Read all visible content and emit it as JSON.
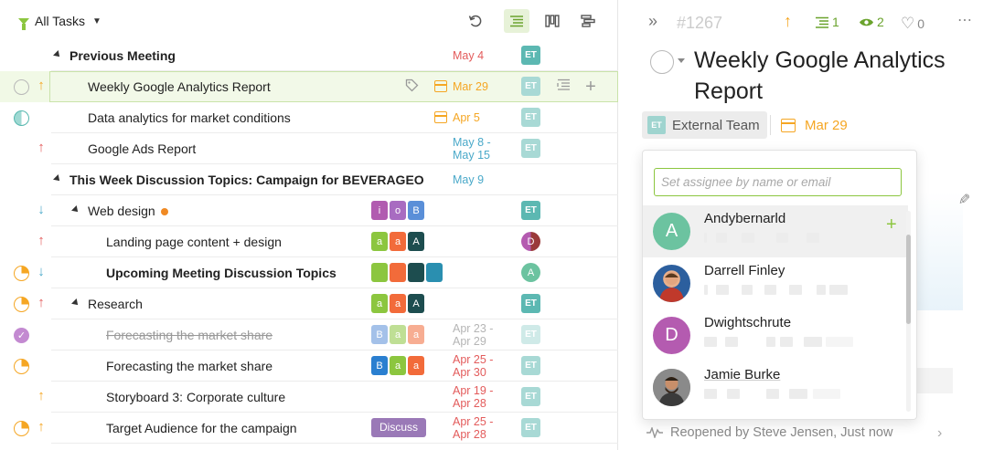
{
  "filter": {
    "label": "All Tasks"
  },
  "rows": [
    {
      "title": "Previous Meeting",
      "date": "May 4"
    },
    {
      "title": "Weekly Google Analytics Report",
      "date": "Mar 29"
    },
    {
      "title": "Data analytics for market conditions",
      "date": "Apr 5"
    },
    {
      "title": "Google Ads Report",
      "date1": "May 8 -",
      "date2": "May 15"
    },
    {
      "title": "This Week Discussion Topics: Campaign for BEVERAGEO",
      "date": "May 9"
    },
    {
      "title": "Web design",
      "tags": [
        "i",
        "o",
        "B"
      ]
    },
    {
      "title": "Landing page content + design",
      "tags": [
        "a",
        "a",
        "A"
      ]
    },
    {
      "title": "Upcoming Meeting Discussion Topics"
    },
    {
      "title": "Research",
      "tags": [
        "a",
        "a",
        "A"
      ]
    },
    {
      "title": "Forecasting the market share",
      "tags": [
        "B",
        "a",
        "a"
      ],
      "date1": "Apr 23 -",
      "date2": "Apr 29"
    },
    {
      "title": "Forecasting the market share",
      "tags": [
        "B",
        "a",
        "a"
      ],
      "date1": "Apr 25 -",
      "date2": "Apr 30"
    },
    {
      "title": "Storyboard 3: Corporate culture",
      "date1": "Apr 19 -",
      "date2": "Apr 28"
    },
    {
      "title": "Target Audience for the campaign",
      "pill": "Discuss",
      "date1": "Apr 25 -",
      "date2": "Apr 28"
    }
  ],
  "avatar_initials": "ET",
  "detail": {
    "task_id": "#1267",
    "subtasks_count": "1",
    "watchers_count": "2",
    "likes_count": "0",
    "title": "Weekly Google Analytics Report",
    "assignee": "External Team",
    "assignee_initials": "ET",
    "due_date": "Mar 29",
    "activity": "Reopened by Steve Jensen, Just now"
  },
  "assignee_picker": {
    "placeholder": "Set assignee by name or email",
    "people": [
      {
        "name": "Andybernarld",
        "initial": "A",
        "color": "#6cc3a0"
      },
      {
        "name": "Darrell Finley",
        "initial": "",
        "color": "#4a6fa5"
      },
      {
        "name": "Dwightschrute",
        "initial": "D",
        "color": "#b45bb0"
      },
      {
        "name": "Jamie Burke",
        "initial": "",
        "color": "#6d6d6d"
      }
    ]
  },
  "colors": {
    "accent": "#8cc63f",
    "teal": "#5cb8b2",
    "date_red": "#e35b5b",
    "date_orange": "#f5a623",
    "date_teal": "#4aa9c9"
  }
}
